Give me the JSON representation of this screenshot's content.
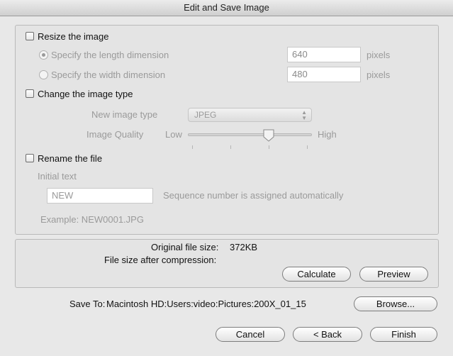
{
  "window": {
    "title": "Edit and Save Image"
  },
  "resize": {
    "checkbox_label": "Resize the image",
    "checked": false,
    "length_option_label": "Specify the length dimension",
    "length_value": "640",
    "width_option_label": "Specify the width dimension",
    "width_value": "480",
    "unit": "pixels",
    "selected_option": "length"
  },
  "image_type": {
    "checkbox_label": "Change the image type",
    "checked": false,
    "type_label": "New image type",
    "type_value": "JPEG",
    "quality_label": "Image Quality",
    "quality_low": "Low",
    "quality_high": "High",
    "quality_level": 0.65
  },
  "rename": {
    "checkbox_label": "Rename the file",
    "checked": false,
    "initial_text_label": "Initial text",
    "initial_text_value": "NEW",
    "sequence_note": "Sequence number is assigned automatically",
    "example": "Example:  NEW0001.JPG"
  },
  "info": {
    "original_size_label": "Original file size:",
    "original_size_value": "372KB",
    "compressed_size_label": "File size after compression:",
    "compressed_size_value": "",
    "calculate_label": "Calculate",
    "preview_label": "Preview"
  },
  "save": {
    "label": "Save To:",
    "path": "Macintosh HD:Users:video:Pictures:200X_01_15",
    "browse_label": "Browse..."
  },
  "footer": {
    "cancel_label": "Cancel",
    "back_label": "< Back",
    "finish_label": "Finish"
  },
  "icons": {
    "select_arrows": "up-down-arrows-icon",
    "slider_knob": "slider-knob-icon"
  },
  "colors": {
    "window_bg": "#e8e8e8",
    "disabled_text": "#9a9a9a"
  }
}
